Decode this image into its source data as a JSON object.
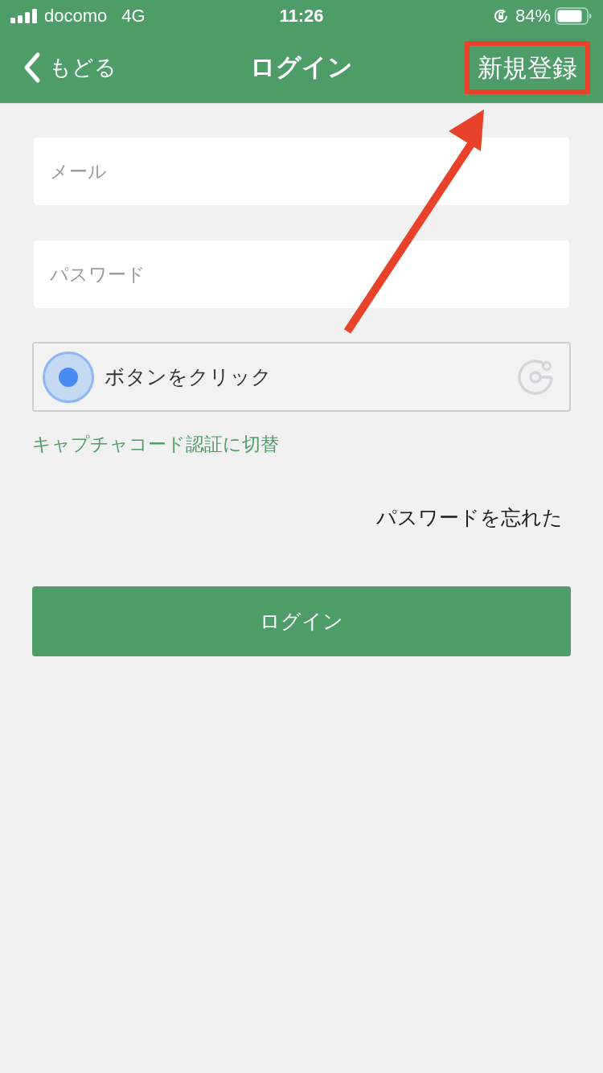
{
  "status_bar": {
    "carrier": "docomo",
    "network": "4G",
    "time": "11:26",
    "battery": "84%"
  },
  "nav_bar": {
    "back_button": {
      "label": "もどる"
    },
    "title": "ログイン",
    "register_button": {
      "label": "新規登録",
      "highlighted": true
    }
  },
  "form": {
    "email_field": {
      "placeholder": "メール"
    },
    "password_field": {
      "placeholder": "パスワード"
    },
    "captcha": {
      "label": "ボタンをクリック"
    },
    "switch_link": "キャプチャコード認証に切替",
    "forgot_link": "パスワードを忘れた",
    "login_button": "ログイン"
  },
  "annotations": [
    {
      "kind": "arrow"
    }
  ]
}
